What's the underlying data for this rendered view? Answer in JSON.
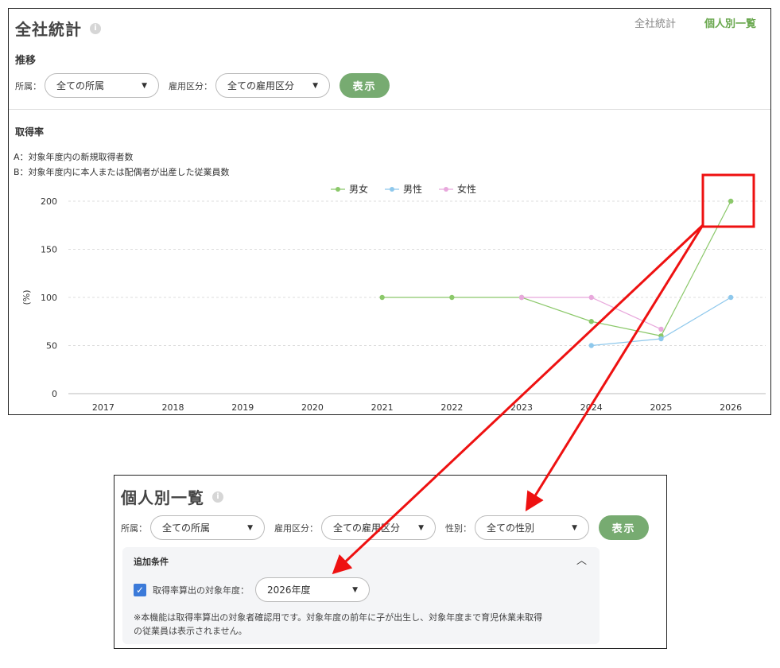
{
  "top": {
    "title": "全社統計",
    "info_icon": "i",
    "tabs": [
      {
        "label": "全社統計",
        "active": false
      },
      {
        "label": "個人別一覧",
        "active": true
      }
    ],
    "section": "推移",
    "filters": {
      "dept_label": "所属：",
      "dept_value": "全ての所属",
      "emp_label": "雇用区分：",
      "emp_value": "全ての雇用区分",
      "show": "表示"
    },
    "chart_title": "取得率",
    "note_a": "A：対象年度内の新規取得者数",
    "note_b": "B：対象年度内に本人または配偶者が出産した従業員数"
  },
  "chart_data": {
    "type": "line",
    "title": "",
    "ylabel": "(%)",
    "xlabel": "",
    "ylim": [
      0,
      200
    ],
    "yticks": [
      0,
      50,
      100,
      150,
      200
    ],
    "categories": [
      "2017",
      "2018",
      "2019",
      "2020",
      "2021",
      "2022",
      "2023",
      "2024",
      "2025",
      "2026"
    ],
    "grid": "horizontal-dashed",
    "legend_position": "top-center",
    "series": [
      {
        "name": "男女",
        "color": "#8bc86a",
        "values": [
          null,
          null,
          null,
          null,
          100,
          100,
          100,
          75,
          60,
          200
        ]
      },
      {
        "name": "男性",
        "color": "#8ec8ec",
        "values": [
          null,
          null,
          null,
          null,
          null,
          null,
          null,
          50,
          57,
          100
        ]
      },
      {
        "name": "女性",
        "color": "#e8a8dc",
        "values": [
          null,
          null,
          null,
          null,
          null,
          null,
          100,
          100,
          67,
          null
        ]
      }
    ]
  },
  "bottom": {
    "title": "個人別一覧",
    "dept_label": "所属：",
    "dept_value": "全ての所属",
    "emp_label": "雇用区分：",
    "emp_value": "全ての雇用区分",
    "gender_label": "性別：",
    "gender_value": "全ての性別",
    "show": "表示",
    "extra_title": "追加条件",
    "year_label": "取得率算出の対象年度：",
    "year_value": "2026年度",
    "note_line1": "※本機能は取得率算出の対象者確認用です。対象年度の前年に子が出生し、対象年度まで育児休業未取得",
    "note_line2": "の従業員は表示されません。"
  },
  "colors": {
    "accent_green": "#77ab71",
    "annotation_red": "#ee1111",
    "checkbox_blue": "#3b7ad9"
  }
}
